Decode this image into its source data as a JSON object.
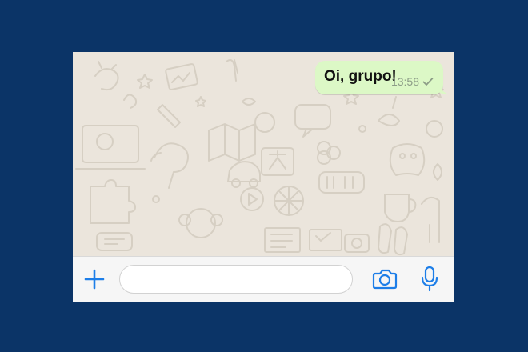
{
  "colors": {
    "page_background": "#0b3467",
    "chat_background": "#ebe5dc",
    "outgoing_bubble": "#dcf8c6",
    "accent": "#1d7ee8",
    "input_bar": "#f6f6f6"
  },
  "chat": {
    "messages": [
      {
        "direction": "outgoing",
        "text": "Oi, grupo!",
        "time": "13:58",
        "status_icon": "check-icon"
      }
    ]
  },
  "input_bar": {
    "attach_icon": "plus-icon",
    "message_value": "",
    "message_placeholder": "",
    "camera_icon": "camera-icon",
    "mic_icon": "microphone-icon"
  }
}
